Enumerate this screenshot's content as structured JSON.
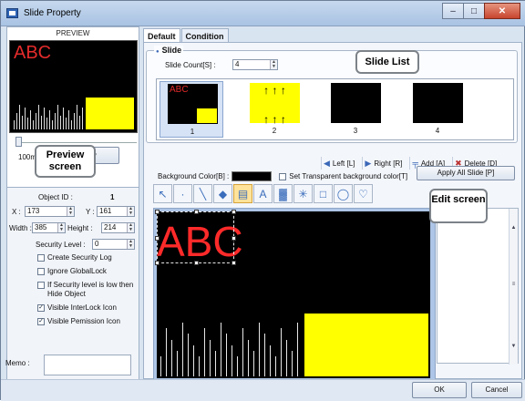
{
  "window": {
    "title": "Slide Property",
    "minimize": "–",
    "maximize": "□",
    "close": "✕"
  },
  "preview": {
    "heading": "PREVIEW",
    "text": "ABC",
    "interval": "100ms",
    "play_label": "Play"
  },
  "callouts": {
    "preview": "Preview screen",
    "slide_list": "Slide List",
    "edit": "Edit screen"
  },
  "object": {
    "id_label": "Object ID :",
    "id_value": "1",
    "x_label": "X :",
    "x_value": "173",
    "y_label": "Y :",
    "y_value": "161",
    "width_label": "Width :",
    "width_value": "385",
    "height_label": "Height :",
    "height_value": "214",
    "security_label": "Security Level :",
    "security_value": "0",
    "checkboxes": [
      {
        "label": "Create Security Log",
        "checked": false
      },
      {
        "label": "Ignore GlobalLock",
        "checked": false
      },
      {
        "label": "If Security level is low then Hide Object",
        "checked": false
      },
      {
        "label": "Visible InterLock Icon",
        "checked": true
      },
      {
        "label": "Visible Pemission Icon",
        "checked": true
      }
    ],
    "memo_label": "Memo :"
  },
  "tabs": [
    {
      "label": "Default",
      "active": true
    },
    {
      "label": "Condition",
      "active": false
    }
  ],
  "slide": {
    "group_title": "Slide",
    "count_label": "Slide Count[S] :",
    "count_value": "4",
    "thumbs": [
      {
        "num": "1",
        "content": "abc-yellow"
      },
      {
        "num": "2",
        "content": "arrows-yellow"
      },
      {
        "num": "3",
        "content": "black"
      },
      {
        "num": "4",
        "content": "black"
      }
    ]
  },
  "actions": {
    "left": "Left [L]",
    "right": "Right [R]",
    "add": "Add [A]",
    "delete": "Delete [D]"
  },
  "background": {
    "color_label": "Background Color[B] :",
    "color_value": "#000000",
    "transparent_label": "Set Transparent background color[T]",
    "apply_all": "Apply All Slide [P]"
  },
  "tools": [
    {
      "name": "pointer-tool-icon",
      "glyph": "↖"
    },
    {
      "name": "dot-tool-icon",
      "glyph": "·"
    },
    {
      "name": "line-tool-icon",
      "glyph": "╲"
    },
    {
      "name": "fill-tool-icon",
      "glyph": "◆"
    },
    {
      "name": "image-tool-icon",
      "glyph": "▤"
    },
    {
      "name": "text-tool-icon",
      "glyph": "A"
    },
    {
      "name": "chart-tool-icon",
      "glyph": "▓"
    },
    {
      "name": "pattern-tool-icon",
      "glyph": "✳"
    },
    {
      "name": "rectangle-tool-icon",
      "glyph": "□"
    },
    {
      "name": "ellipse-tool-icon",
      "glyph": "◯"
    },
    {
      "name": "polygon-tool-icon",
      "glyph": "♡"
    }
  ],
  "canvas": {
    "text": "ABC",
    "text_color": "#ff2a2a",
    "fill_color": "#ffff00"
  },
  "buttons": {
    "ok": "OK",
    "cancel": "Cancel"
  }
}
